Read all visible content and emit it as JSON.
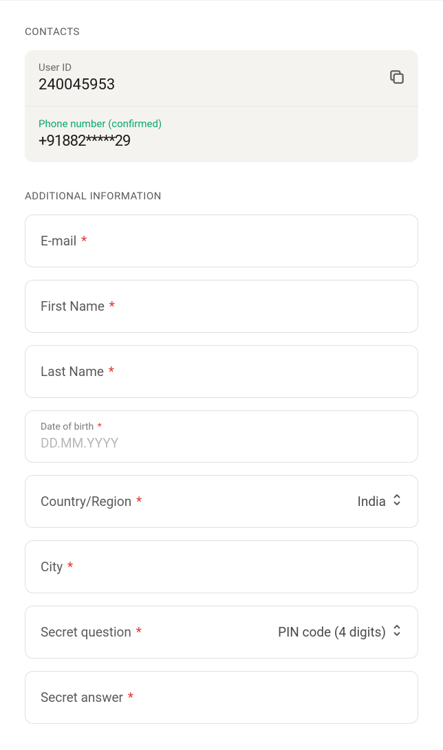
{
  "sections": {
    "contacts_title": "CONTACTS",
    "additional_title": "ADDITIONAL INFORMATION"
  },
  "contacts": {
    "user_id_label": "User ID",
    "user_id_value": "240045953",
    "phone_label": "Phone number (confirmed)",
    "phone_value": "+91882*****29"
  },
  "fields": {
    "email": {
      "label": "E-mail"
    },
    "first_name": {
      "label": "First Name"
    },
    "last_name": {
      "label": "Last Name"
    },
    "dob": {
      "label": "Date of birth",
      "placeholder": "DD.MM.YYYY"
    },
    "country": {
      "label": "Country/Region",
      "value": "India"
    },
    "city": {
      "label": "City"
    },
    "secret_question": {
      "label": "Secret question",
      "value": "PIN code (4 digits)"
    },
    "secret_answer": {
      "label": "Secret answer"
    }
  }
}
